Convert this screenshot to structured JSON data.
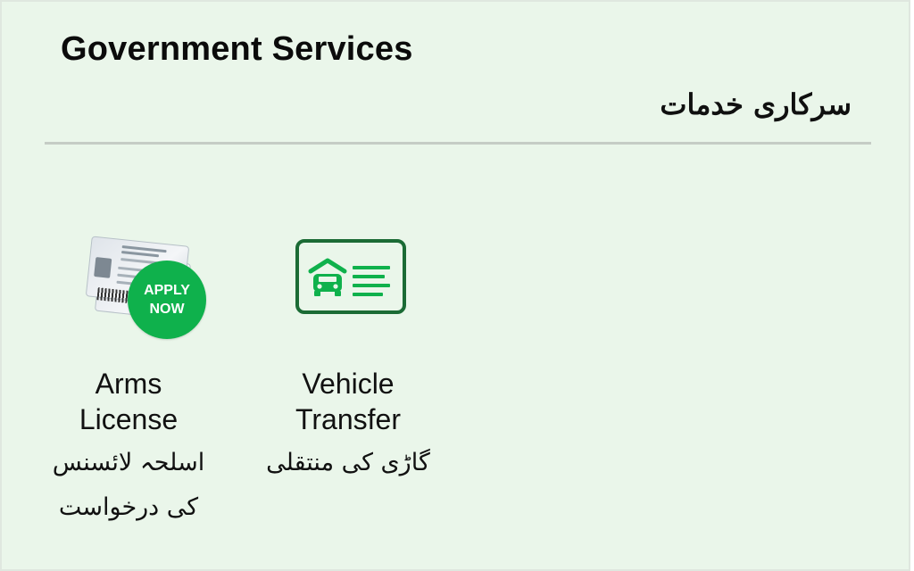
{
  "header": {
    "title_en": "Government Services",
    "title_ur": "سرکاری خدمات"
  },
  "services": [
    {
      "icon": "arms-license-card-icon",
      "badge_line1": "APPLY",
      "badge_line2": "NOW",
      "label_en_line1": "Arms",
      "label_en_line2": "License",
      "label_ur_line1": "اسلحہ لائسنس",
      "label_ur_line2": "کی درخواست"
    },
    {
      "icon": "vehicle-transfer-icon",
      "label_en_line1": "Vehicle",
      "label_en_line2": "Transfer",
      "label_ur_line1": "گاڑی کی منتقلی"
    }
  ],
  "colors": {
    "background": "#eaf6ea",
    "accent_green": "#0fb14c",
    "icon_dark_green": "#1b6b35",
    "divider": "#c5ccc5"
  }
}
